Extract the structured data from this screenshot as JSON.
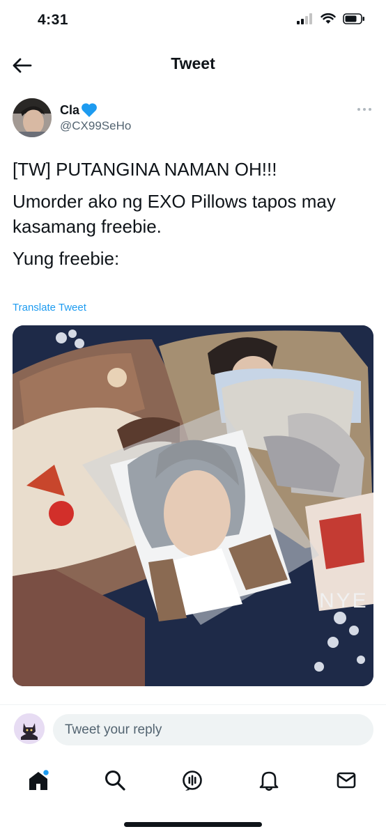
{
  "status_bar": {
    "time": "4:31"
  },
  "header": {
    "title": "Tweet"
  },
  "author": {
    "name": "Cla",
    "name_emoji": "💙",
    "handle": "@CX99SeHo"
  },
  "tweet": {
    "lines": [
      "[TW] PUTANGINA NAMAN OH!!!",
      "Umorder ako ng EXO Pillows tapos may kasamang freebie.",
      "Yung freebie:"
    ],
    "translate_label": "Translate Tweet",
    "photo_text": "NYE"
  },
  "reply": {
    "placeholder": "Tweet your reply"
  },
  "tab_bar": {
    "items": [
      "home-icon",
      "search-icon",
      "spaces-icon",
      "notifications-icon",
      "messages-icon"
    ]
  },
  "colors": {
    "accent": "#1d9bf0",
    "text": "#0f1419",
    "secondary": "#536471",
    "heart": "#1d9bf0"
  }
}
